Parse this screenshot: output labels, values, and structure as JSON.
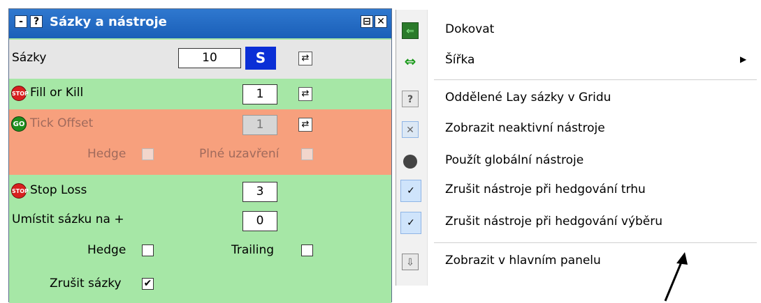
{
  "panel": {
    "title": "Sázky a nástroje",
    "title_buttons": {
      "minimize": "-",
      "help": "?",
      "dock": "⊟",
      "close": "✕"
    },
    "stake_row": {
      "label": "Sázky",
      "value": "10",
      "s_button": "S"
    },
    "fill_or_kill": {
      "label": "Fill or Kill",
      "value": "1"
    },
    "tick_offset": {
      "label": "Tick Offset",
      "value": "1",
      "hedge_label": "Hedge",
      "full_close_label": "Plné uzavření"
    },
    "stop_loss": {
      "label": "Stop Loss",
      "value": "3",
      "place_label": "Umístit sázku na +",
      "place_value": "0",
      "hedge_label": "Hedge",
      "trailing_label": "Trailing",
      "cancel_label": "Zrušit sázky",
      "cancel_checked_mark": "✔"
    },
    "icons": {
      "stop_text": "STOP",
      "go_text": "GO",
      "refresh": "⇄"
    },
    "colors": {
      "green": "#a6e7a6",
      "salmon": "#f7a07d",
      "title_blue": "#1a5fb8",
      "s_blue": "#0a2fd6"
    }
  },
  "menu": {
    "items": [
      {
        "label": "Dokovat",
        "icon": "dock-left-icon"
      },
      {
        "label": "Šířka",
        "icon": "width-arrows-icon",
        "submenu_arrow": "▶"
      },
      {
        "label": "Oddělené Lay sázky v Gridu",
        "icon": "question-icon"
      },
      {
        "label": "Zobrazit neaktivní nástroje",
        "icon": "tools-icon"
      },
      {
        "label": "Použít globální nástroje",
        "icon": "globe-icon"
      },
      {
        "label": "Zrušit nástroje při hedgování trhu",
        "icon": "check-icon",
        "checked": "✓"
      },
      {
        "label": "Zrušit nástroje při hedgování výběru",
        "icon": "check-icon",
        "checked": "✓"
      },
      {
        "label": "Zobrazit v hlavním panelu",
        "icon": "down-arrow-icon"
      }
    ]
  }
}
